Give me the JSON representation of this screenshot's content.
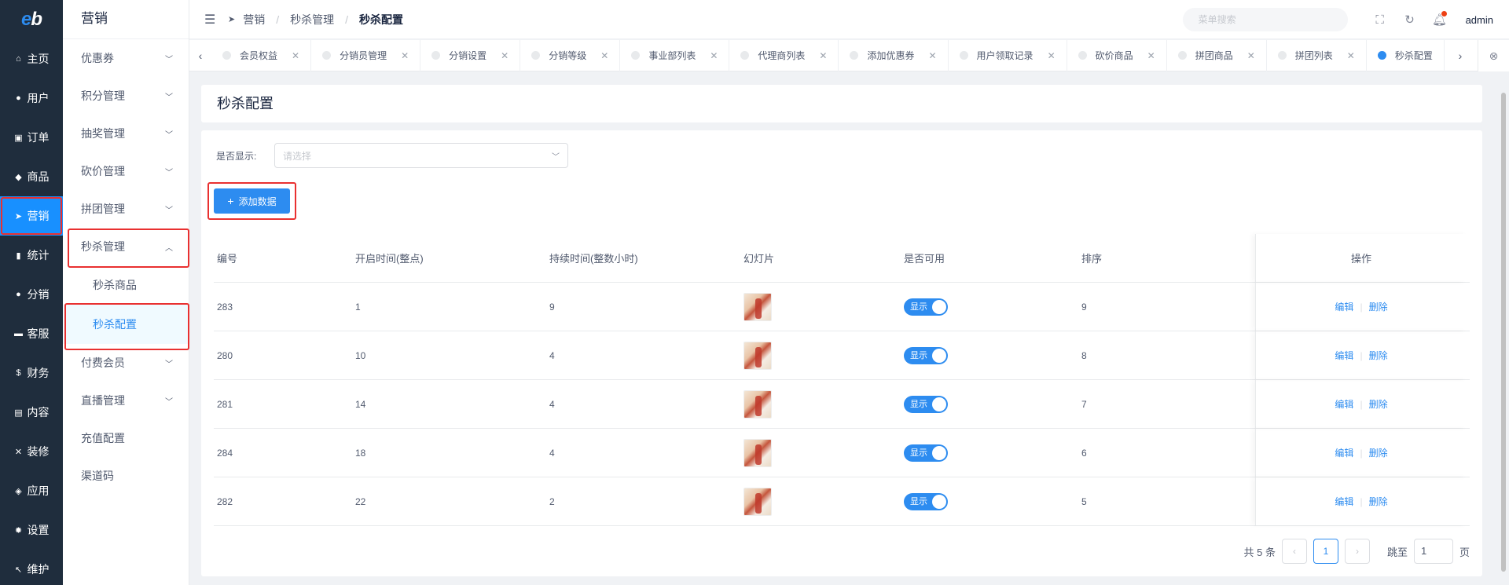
{
  "rail": {
    "logo": "eb",
    "items": [
      {
        "label": "主页",
        "icon": "home-icon",
        "glyph": "⌂"
      },
      {
        "label": "用户",
        "icon": "user-icon",
        "glyph": "●"
      },
      {
        "label": "订单",
        "icon": "cart-icon",
        "glyph": "▣"
      },
      {
        "label": "商品",
        "icon": "basket-icon",
        "glyph": "◆"
      },
      {
        "label": "营销",
        "icon": "send-icon",
        "glyph": "➤"
      },
      {
        "label": "统计",
        "icon": "bar-chart-icon",
        "glyph": "▮"
      },
      {
        "label": "分销",
        "icon": "group-icon",
        "glyph": "●"
      },
      {
        "label": "客服",
        "icon": "chat-icon",
        "glyph": "▬"
      },
      {
        "label": "财务",
        "icon": "dollar-icon",
        "glyph": "$"
      },
      {
        "label": "内容",
        "icon": "book-icon",
        "glyph": "▤"
      },
      {
        "label": "装修",
        "icon": "tools-icon",
        "glyph": "✕"
      },
      {
        "label": "应用",
        "icon": "cube-icon",
        "glyph": "◈"
      },
      {
        "label": "设置",
        "icon": "gear-icon",
        "glyph": "✹"
      },
      {
        "label": "维护",
        "icon": "wrench-icon",
        "glyph": "↖"
      }
    ]
  },
  "submenu": {
    "title": "营销",
    "groups": [
      {
        "label": "优惠券"
      },
      {
        "label": "积分管理"
      },
      {
        "label": "抽奖管理"
      },
      {
        "label": "砍价管理"
      },
      {
        "label": "拼团管理"
      },
      {
        "label": "秒杀管理"
      }
    ],
    "seckill_children": [
      {
        "label": "秒杀商品"
      },
      {
        "label": "秒杀配置"
      }
    ],
    "groups_after": [
      {
        "label": "付费会员",
        "chevron": true
      },
      {
        "label": "直播管理",
        "chevron": true
      },
      {
        "label": "充值配置",
        "chevron": false
      },
      {
        "label": "渠道码",
        "chevron": false
      }
    ]
  },
  "header": {
    "breadcrumb": [
      "营销",
      "秒杀管理",
      "秒杀配置"
    ],
    "search_placeholder": "菜单搜索",
    "user": "admin"
  },
  "tabs": [
    "会员权益",
    "分销员管理",
    "分销设置",
    "分销等级",
    "事业部列表",
    "代理商列表",
    "添加优惠券",
    "用户领取记录",
    "砍价商品",
    "拼团商品",
    "拼团列表",
    "秒杀配置"
  ],
  "page": {
    "title": "秒杀配置",
    "filter_label": "是否显示:",
    "filter_placeholder": "请选择",
    "add_button": "添加数据",
    "columns": [
      "编号",
      "开启时间(整点)",
      "持续时间(整数小时)",
      "幻灯片",
      "是否可用",
      "排序",
      "操作"
    ],
    "rows": [
      {
        "id": "283",
        "start": "1",
        "duration": "9",
        "status": "显示",
        "sort": "9"
      },
      {
        "id": "280",
        "start": "10",
        "duration": "4",
        "status": "显示",
        "sort": "8"
      },
      {
        "id": "281",
        "start": "14",
        "duration": "4",
        "status": "显示",
        "sort": "7"
      },
      {
        "id": "284",
        "start": "18",
        "duration": "4",
        "status": "显示",
        "sort": "6"
      },
      {
        "id": "282",
        "start": "22",
        "duration": "2",
        "status": "显示",
        "sort": "5"
      }
    ],
    "edit_label": "编辑",
    "delete_label": "删除",
    "pager": {
      "total": "共 5 条",
      "current": "1",
      "jump_label": "跳至",
      "jump_value": "1",
      "page_suffix": "页"
    }
  },
  "colors": {
    "accent": "#2d8cf0",
    "rail_bg": "#1f2d3d",
    "rail_active": "#1890ff",
    "highlight": "#e93030"
  }
}
